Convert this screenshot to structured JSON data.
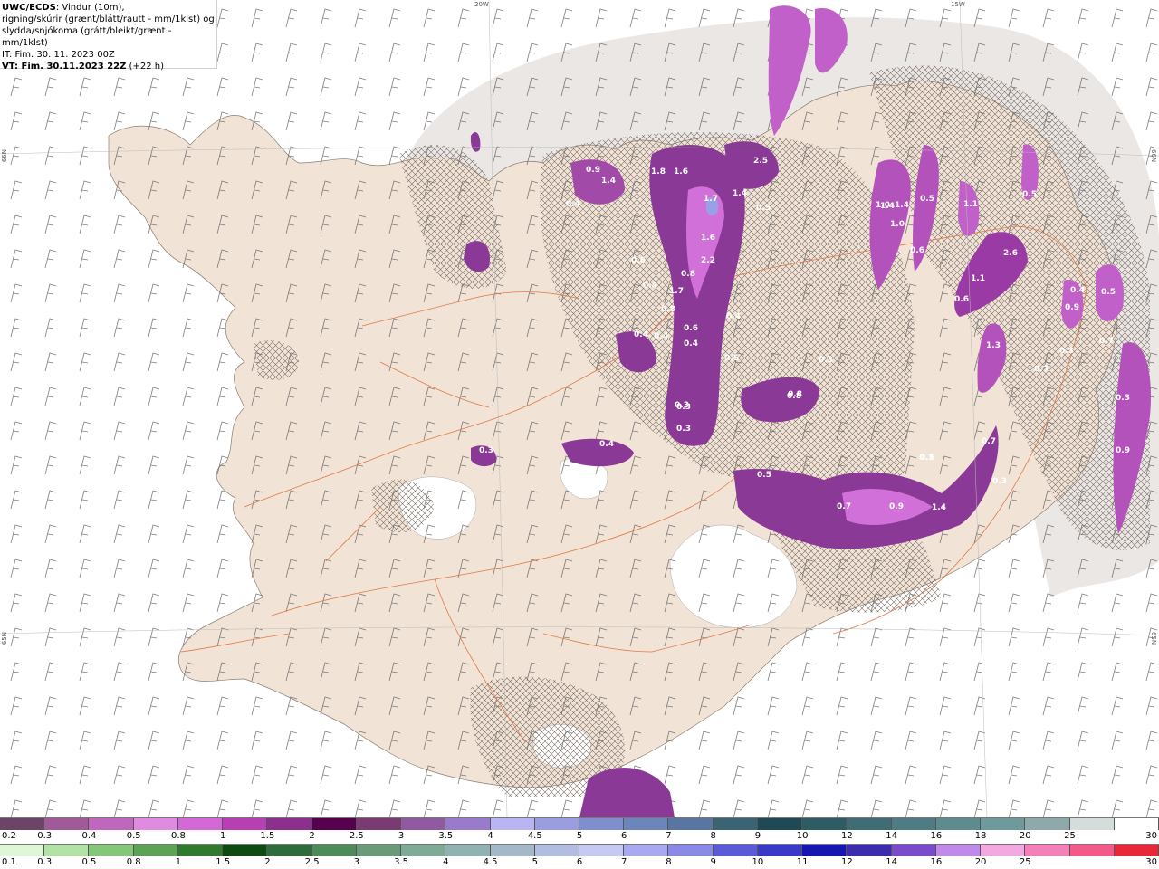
{
  "info": {
    "title_bold": "UWC/ECDS",
    "title_rest": ": Vindur (10m),",
    "line2": "rigning/skúrir (grænt/blátt/rautt - mm/1klst) og",
    "line3": "slydda/snjókoma (grátt/bleikt/grænt - mm/1klst)",
    "line4": "IT: Fim. 30. 11. 2023 00Z",
    "line5_bold": "VT: Fim. 30.11.2023 22Z",
    "line5_rest": " (+22 h)"
  },
  "grid_labels": {
    "lon_20w": "20W",
    "lon_15w": "15W",
    "lat_left_top": "66N",
    "lat_right_top": "66N",
    "lat_left_bottom": "65N",
    "lat_right_bottom": "65N"
  },
  "precip_labels": [
    "0.9",
    "1.4",
    "1.8",
    "1.6",
    "2.5",
    "1.7",
    "1.4",
    "0.5",
    "0.4",
    "1.6",
    "2.2",
    "0.8",
    "1.7",
    "0.8",
    "0.4",
    "0.4",
    "0.5",
    "0.3",
    "0.3",
    "0.4",
    "0.8",
    "0.3",
    "0.4",
    "0.5",
    "0.9",
    "0.7",
    "1.4",
    "0.7",
    "0.3",
    "0.5",
    "1.0",
    "1.4",
    "1.0",
    "0.6",
    "0.5",
    "1.1",
    "2.6",
    "0.6",
    "1.3",
    "0.5",
    "0.9",
    "0.4",
    "0.5",
    "0.9",
    "0.3",
    "0.7",
    "0.3",
    "0.7",
    "0.6",
    "0.4",
    "0.4",
    "0.6",
    "0.3",
    "1.1",
    "1.4",
    "0.8",
    "0.3",
    "0.3"
  ],
  "legend_snow": {
    "colors": [
      "#6b4466",
      "#a05a9a",
      "#c166bd",
      "#e08ae0",
      "#d468d6",
      "#b53fb3",
      "#8d2f8c",
      "#57004d",
      "#7a3a72",
      "#8f5aa0",
      "#9a7acb",
      "#b9b5f2",
      "#9a9ee0",
      "#7f8fce",
      "#6c86bb",
      "#58769f",
      "#3a6473",
      "#1f4a55",
      "#2d5c63",
      "#3e6e74",
      "#4d7c82",
      "#5e8b8e",
      "#6f9a9c",
      "#8fa9aa",
      "#d4dcdc",
      "#ffffff"
    ],
    "labels": [
      "0.2",
      "0.3",
      "0.4",
      "0.5",
      "0.8",
      "1",
      "1.5",
      "2",
      "2.5",
      "3",
      "3.5",
      "4",
      "4.5",
      "5",
      "6",
      "7",
      "8",
      "9",
      "10",
      "12",
      "14",
      "16",
      "18",
      "20",
      "25",
      "30"
    ]
  },
  "legend_rain": {
    "colors": [
      "#dff6d8",
      "#b2e2a5",
      "#86c67b",
      "#5ea257",
      "#2f7a2f",
      "#0f4a12",
      "#2f6b3d",
      "#4f8a5a",
      "#6a9a7a",
      "#7faa95",
      "#90b2b0",
      "#a4b8c8",
      "#b3bde0",
      "#c6c9f2",
      "#a9a9ef",
      "#8a8ae6",
      "#5b5bd8",
      "#3a3ac8",
      "#1616b0",
      "#3c2cae",
      "#7a4ccc",
      "#c08ae8",
      "#f2a9e0",
      "#f480b8",
      "#f25a8a",
      "#e8283a"
    ],
    "labels": [
      "0.1",
      "0.3",
      "0.5",
      "0.8",
      "1",
      "1.5",
      "2",
      "2.5",
      "3",
      "3.5",
      "4",
      "4.5",
      "5",
      "6",
      "7",
      "8",
      "9",
      "10",
      "11",
      "12",
      "14",
      "16",
      "20",
      "25",
      "30"
    ]
  }
}
